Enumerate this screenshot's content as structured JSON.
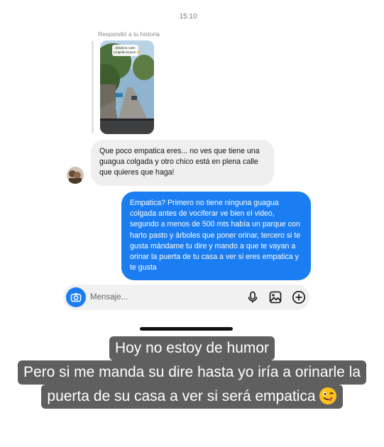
{
  "status": {
    "time": "15:10"
  },
  "story_reply": {
    "caption": "Respondió a tu historia",
    "sticker_lines": [
      "Dónde la cuelo",
      "La gente es peor 🙄"
    ]
  },
  "messages": {
    "incoming": "Que poco empatica eres... no ves que tiene una guagua colgada y otro chico está en plena calle que quieres que haga!",
    "outgoing": "Empatica? Primero no tiene ninguna guagua colgada antes de vociferar ve bien el video, segundo a menos de 500 mts había un parque con harto pasto y árboles que poner orinar, tercero si te gusta mándame tu dire y mando a que te vayan a orinar la puerta de tu casa a ver si eres empatica y te gusta"
  },
  "composer": {
    "placeholder": "Mensaje...",
    "icons": [
      "camera-icon",
      "microphone-icon",
      "gallery-icon",
      "plus-icon"
    ]
  },
  "overlay_caption": {
    "line1": "Hoy no estoy de humor",
    "line2": "Pero si me manda su dire hasta yo iría a orinarle la",
    "line3": "puerta de su casa a ver si será empatica",
    "emoji": "winking-face-with-tongue"
  },
  "colors": {
    "accent_blue": "#1a7df2",
    "incoming_bubble": "#efefef",
    "caption_bg": "#5f5f5f"
  }
}
